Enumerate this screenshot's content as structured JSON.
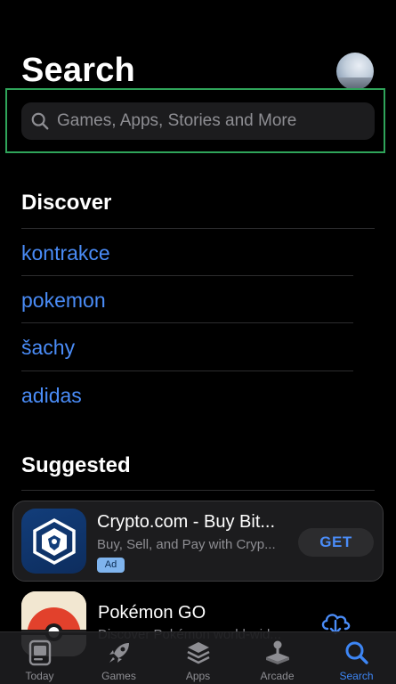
{
  "header": {
    "title": "Search"
  },
  "search": {
    "placeholder": "Games, Apps, Stories and More"
  },
  "discover": {
    "title": "Discover",
    "items": [
      "kontrakce",
      "pokemon",
      "šachy",
      "adidas"
    ]
  },
  "suggested": {
    "title": "Suggested",
    "apps": [
      {
        "name": "Crypto.com - Buy Bit...",
        "subtitle": "Buy, Sell, and Pay with Cryp...",
        "badge": "Ad",
        "action": "GET",
        "icon": "crypto-lion-shield-icon"
      },
      {
        "name": "Pokémon GO",
        "subtitle": "Discover Pokémon world-wid...",
        "action_icon": "cloud-download-icon",
        "icon": "pokeball-icon"
      }
    ]
  },
  "tabs": [
    {
      "label": "Today",
      "icon": "today-icon",
      "active": false
    },
    {
      "label": "Games",
      "icon": "rocket-icon",
      "active": false
    },
    {
      "label": "Apps",
      "icon": "apps-stack-icon",
      "active": false
    },
    {
      "label": "Arcade",
      "icon": "joystick-icon",
      "active": false
    },
    {
      "label": "Search",
      "icon": "search-icon",
      "active": true
    }
  ],
  "colors": {
    "background": "#000000",
    "accent": "#4a8cf7",
    "secondary_text": "#8e8e93",
    "highlight": "#2fa45a"
  }
}
